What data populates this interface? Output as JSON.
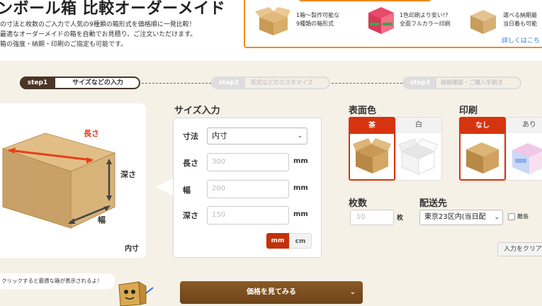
{
  "header": {
    "title": "ンボール箱 比較オーダーメイド",
    "desc_lines": [
      "の寸法と枚数のご入力で人気の9種類の箱形式を価格順に一発比較！",
      "最適なオーダーメイドの箱を自動でお見積り、ご注文いただけます。",
      "箱の強度・納期・印刷のご指定も可能です。"
    ]
  },
  "promo": {
    "item1": [
      "1箱～製作可能な",
      "9種類の箱形式"
    ],
    "item2": [
      "1色印刷より安い!?",
      "全面フルカラー印刷"
    ],
    "item3": [
      "選べる納期最",
      "当日着も可能"
    ],
    "link": "詳しくはこち"
  },
  "steps": [
    {
      "num": "step1",
      "label": "サイズなどの入力"
    },
    {
      "num": "step2",
      "label": "形式などのカスタマイズ"
    },
    {
      "num": "step3",
      "label": "価格確認・ご購入手続き"
    }
  ],
  "box_diagram": {
    "length": "長さ",
    "depth": "深さ",
    "width": "幅",
    "inner": "内寸"
  },
  "size_input": {
    "title": "サイズ入力",
    "dim_label": "寸法",
    "dim_value": "内寸",
    "length_label": "長さ",
    "length_placeholder": "300",
    "width_label": "幅",
    "width_placeholder": "200",
    "depth_label": "深さ",
    "depth_placeholder": "150",
    "unit": "mm",
    "toggle_mm": "mm",
    "toggle_cm": "cm"
  },
  "surface_color": {
    "title": "表面色",
    "options": [
      {
        "label": "茶",
        "selected": true
      },
      {
        "label": "白",
        "selected": false
      }
    ]
  },
  "printing": {
    "title": "印刷",
    "options": [
      {
        "label": "なし",
        "selected": true
      },
      {
        "label": "あり",
        "selected": false
      }
    ]
  },
  "quantity": {
    "title": "枚数",
    "placeholder": "10",
    "unit": "枚"
  },
  "shipping": {
    "title": "配送先",
    "value": "東京23区内(当日配",
    "island_label": "離島"
  },
  "clear_button": "入力をクリア",
  "mascot_bubble": "クリックすると最適な箱が表示されるよ！",
  "price_button": "価格を見てみる",
  "colors": {
    "accent": "#d6340e",
    "step_dark": "#4a3527",
    "brown_button": "#7a4f21",
    "beige_bg": "#f6f1e7",
    "promo_border": "#f08a1d"
  }
}
